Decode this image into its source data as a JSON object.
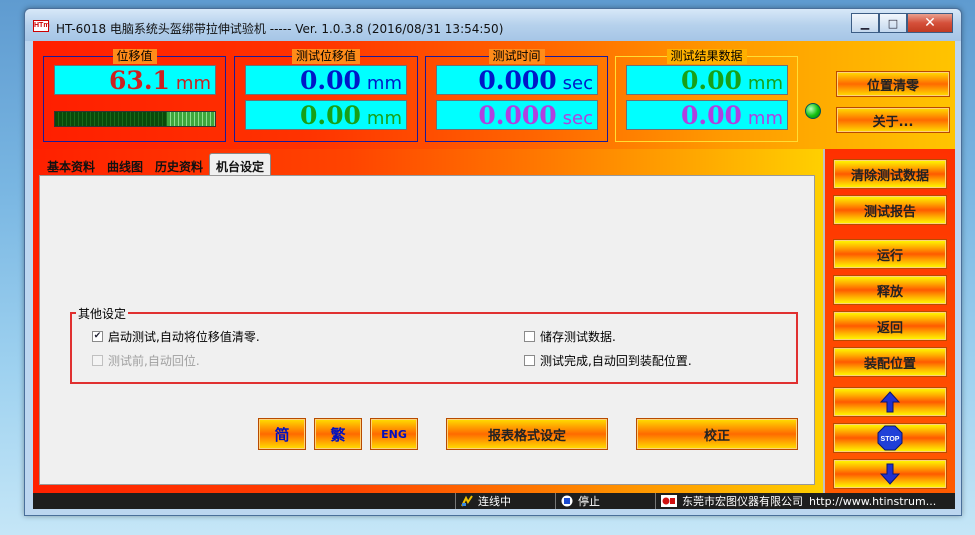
{
  "window": {
    "title": "HT-6018 电脑系统头盔绑带拉伸试验机 ----- Ver. 1.0.3.8 (2016/08/31 13:54:50)",
    "logo_text": "HTm",
    "minimize": "▁",
    "maximize": "□",
    "close": "✕"
  },
  "meters": {
    "displacement": {
      "label": "位移值",
      "value": "63.1",
      "unit": "mm",
      "bar_percent": 30
    },
    "test_displacement": {
      "label": "测试位移值",
      "row1": {
        "value": "0.00",
        "unit": "mm"
      },
      "row2": {
        "value": "0.00",
        "unit": "mm"
      }
    },
    "test_time": {
      "label": "测试时间",
      "row1": {
        "value": "0.000",
        "unit": "sec"
      },
      "row2": {
        "value": "0.000",
        "unit": "sec"
      }
    },
    "result": {
      "label": "测试结果数据",
      "row1": {
        "value": "0.00",
        "unit": "mm"
      },
      "row2": {
        "value": "0.00",
        "unit": "mm"
      }
    }
  },
  "top_buttons": {
    "zero": "位置清零",
    "about": "关于..."
  },
  "tabs": [
    {
      "label": "基本资料"
    },
    {
      "label": "曲线图"
    },
    {
      "label": "历史资料"
    },
    {
      "label": "机台设定"
    }
  ],
  "other_settings": {
    "legend": "其他设定",
    "auto_zero": {
      "label": "启动测试,自动将位移值清零.",
      "checked": true
    },
    "auto_return": {
      "label": "测试前,自动回位.",
      "checked": false,
      "disabled": true
    },
    "save_data": {
      "label": "储存测试数据.",
      "checked": false
    },
    "return_to_fit": {
      "label": "测试完成,自动回到装配位置.",
      "checked": false
    }
  },
  "bottom_buttons": {
    "simplified": "简",
    "traditional": "繁",
    "english": "ENG",
    "report_format": "报表格式设定",
    "calibrate": "校正"
  },
  "right_buttons": {
    "clear_data": "清除测试数据",
    "report": "测试报告",
    "run": "运行",
    "release": "释放",
    "back": "返回",
    "fit_position": "装配位置",
    "stop": "STOP"
  },
  "status_bar": {
    "connection": "连线中",
    "state": "停止",
    "company": "东莞市宏图仪器有限公司",
    "url": "http://www.htinstrum..."
  },
  "colors": {
    "red_value": "#cc2020",
    "blue_value": "#0018c8",
    "green_value": "#18a018",
    "purple_value": "#b040e0"
  }
}
